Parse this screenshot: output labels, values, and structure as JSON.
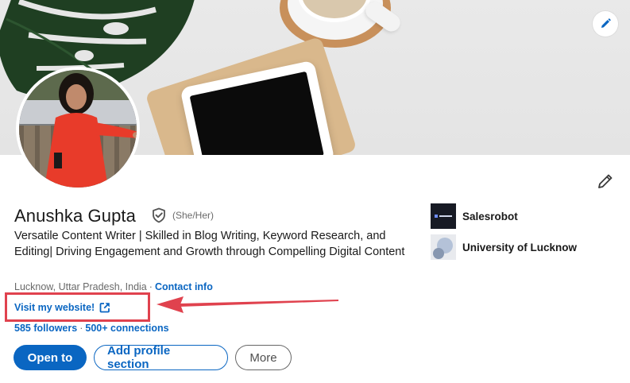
{
  "profile": {
    "name": "Anushka Gupta",
    "pronouns": "(She/Her)",
    "headline": "Versatile Content Writer | Skilled in Blog Writing, Keyword Research, and Editing| Driving Engagement and Growth through Compelling Digital Content",
    "location": "Lucknow, Uttar Pradesh, India",
    "separator": "·",
    "contact_label": "Contact info",
    "website_label": "Visit my website!",
    "followers": "585 followers",
    "stats_separator": "·",
    "connections": "500+ connections"
  },
  "actions": {
    "open_to": "Open to",
    "add_section": "Add profile section",
    "more": "More"
  },
  "organizations": [
    {
      "name": "Salesrobot",
      "logo_icon": "salesrobot-logo"
    },
    {
      "name": "University of Lucknow",
      "logo_icon": "university-logo"
    }
  ],
  "colors": {
    "brand_blue": "#0a66c2",
    "annotation_red": "#e0424e"
  },
  "icons": {
    "cover_edit": "pencil-icon",
    "profile_edit": "pencil-icon",
    "verified": "shield-check-icon",
    "external_link": "external-link-icon"
  }
}
